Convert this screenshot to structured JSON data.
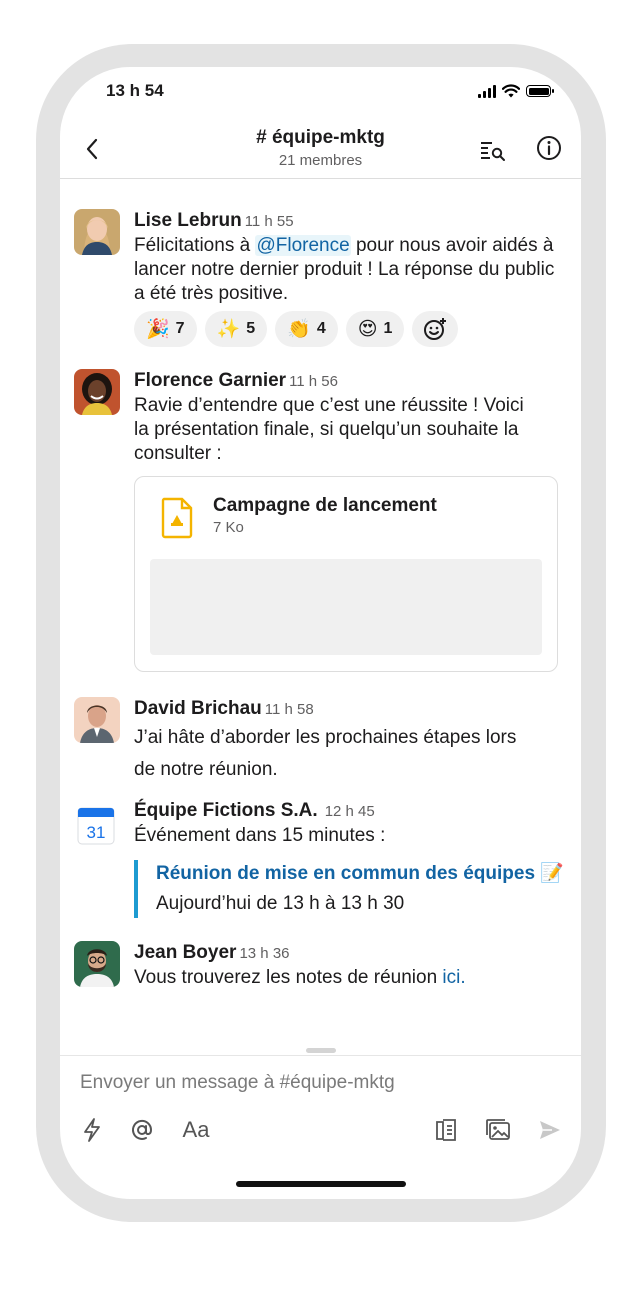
{
  "status": {
    "time": "13 h 54",
    "signal_icon": "cellular-signal-icon",
    "wifi_icon": "wifi-icon",
    "battery_icon": "battery-icon"
  },
  "header": {
    "channel_name": "# équipe-mktg",
    "members": "21 membres",
    "back_icon": "chevron-left-icon",
    "search_icon": "search-list-icon",
    "info_icon": "info-icon"
  },
  "messages": [
    {
      "author": "Lise Lebrun",
      "time": "11 h 55",
      "text_before": "Félicitations à ",
      "mention": "@Florence",
      "text_after": " pour nous avoir aidés à lancer notre dernier produit ! La réponse du public a été très positive.",
      "reactions": [
        {
          "emoji": "🎉",
          "count": "7"
        },
        {
          "emoji": "✨",
          "count": "5"
        },
        {
          "emoji": "👏",
          "count": "4"
        },
        {
          "emoji": "😍",
          "count": "1"
        }
      ],
      "add_reaction_icon": "add-reaction-icon"
    },
    {
      "author": "Florence Garnier",
      "time": "11 h 56",
      "text": "Ravie d’entendre que c’est une réussite ! Voici la présentation finale, si quelqu’un souhaite la consulter :",
      "file": {
        "name": "Campagne de lancement",
        "size": "7 Ko",
        "icon": "google-slides-file-icon"
      }
    },
    {
      "author": "David Brichau",
      "time": "11 h 58",
      "text": "J’ai hâte d’aborder les prochaines étapes lors de notre réunion."
    },
    {
      "author": "Équipe Fictions S.A.",
      "time": "12 h 45",
      "text": "Événement dans 15 minutes :",
      "calendar_day": "31",
      "event": {
        "title": "Réunion de mise en commun des équipes",
        "title_emoji": "📝",
        "when": "Aujourd’hui de 13 h à 13 h 30"
      }
    },
    {
      "author": "Jean Boyer",
      "time": "13 h 36",
      "text_before": "Vous trouverez les notes de réunion ",
      "link": "ici",
      "text_after": "."
    }
  ],
  "composer": {
    "placeholder": "Envoyer un message à #équipe-mktg",
    "format_label": "Aa",
    "tools": [
      "lightning-icon",
      "mention-icon",
      "format-text-icon",
      "attach-file-icon",
      "image-icon",
      "send-icon"
    ]
  },
  "colors": {
    "link": "#1264a3",
    "mention_bg": "#e8f5fa",
    "quote_bar": "#1d9bd1",
    "frame": "#e3e3e3"
  }
}
